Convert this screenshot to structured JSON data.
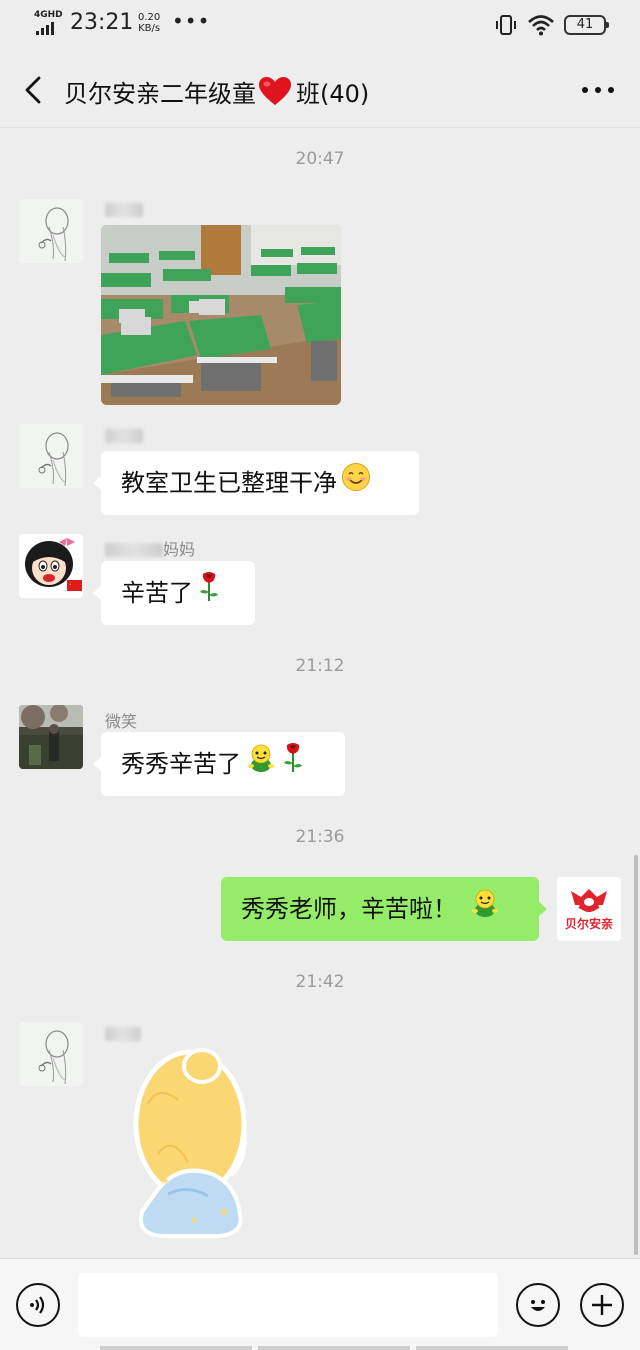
{
  "status_bar": {
    "network": "4GHD",
    "time": "23:21",
    "speed_value": "0.20",
    "speed_unit": "KB/s",
    "battery": "41"
  },
  "header": {
    "title_prefix": "贝尔安亲二年级童",
    "title_suffix": "班(40)",
    "icons": [
      "back-icon",
      "heart-icon",
      "more-icon"
    ]
  },
  "messages": {
    "ts1": "20:47",
    "ts2": "21:12",
    "ts3": "21:36",
    "ts4": "21:42",
    "m2_text": "教室卫生已整理干净",
    "m3_sender_suffix": "妈妈",
    "m3_text": "辛苦了",
    "m4_sender": "微笑",
    "m4_text": "秀秀辛苦了",
    "m5_text": "秀秀老师，辛苦啦！",
    "logo_text": "贝尔安亲"
  },
  "input": {
    "placeholder": ""
  },
  "colors": {
    "background": "#ededed",
    "bubble_self": "#95ec69",
    "bubble_other": "#ffffff",
    "logo_red": "#e2232e"
  }
}
